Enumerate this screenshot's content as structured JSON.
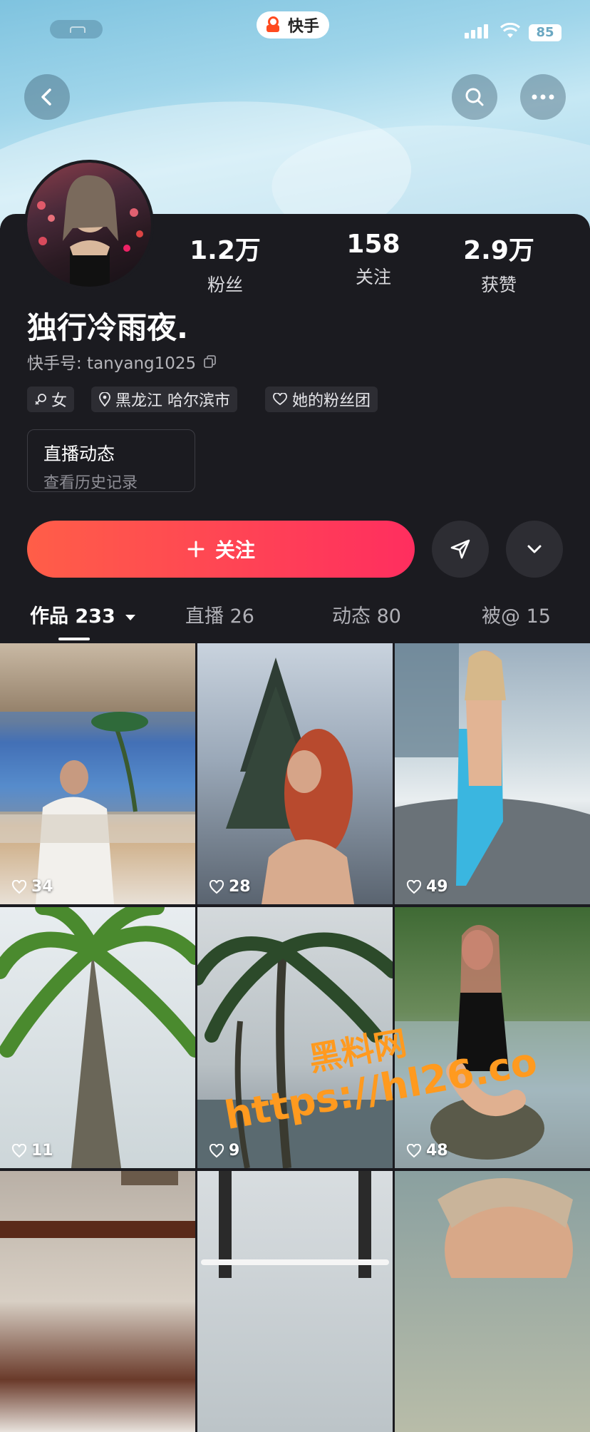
{
  "app": {
    "brand_name": "快手",
    "battery": "85"
  },
  "profile": {
    "name": "独行冷雨夜.",
    "kuaishou_id_label": "快手号: tanyang1025",
    "stats": [
      {
        "value": "1.2万",
        "label": "粉丝"
      },
      {
        "value": "158",
        "label": "关注"
      },
      {
        "value": "2.9万",
        "label": "获赞"
      }
    ],
    "tags": [
      {
        "icon": "gender-icon",
        "text": "女"
      },
      {
        "icon": "location-pin-icon",
        "text": "黑龙江 哈尔滨市"
      },
      {
        "icon": "heart-badge-icon",
        "text": "她的粉丝团"
      }
    ],
    "live_card": {
      "title": "直播动态",
      "subtitle": "查看历史记录"
    }
  },
  "actions": {
    "follow_label": "关注"
  },
  "tabs": [
    {
      "label": "作品 233",
      "active": true
    },
    {
      "label": "直播 26",
      "active": false
    },
    {
      "label": "动态 80",
      "active": false
    },
    {
      "label": "被@ 15",
      "active": false
    }
  ],
  "videos": [
    {
      "likes": "34"
    },
    {
      "likes": "28"
    },
    {
      "likes": "49"
    },
    {
      "likes": "11"
    },
    {
      "likes": "9"
    },
    {
      "likes": "48"
    },
    {
      "likes": ""
    },
    {
      "likes": ""
    },
    {
      "likes": ""
    }
  ],
  "watermark": {
    "line1": "黑料网",
    "line2": "https://hl26.co"
  },
  "colors": {
    "accent_start": "#ff5e48",
    "accent_end": "#ff2e5f",
    "background": "#1b1b20"
  }
}
